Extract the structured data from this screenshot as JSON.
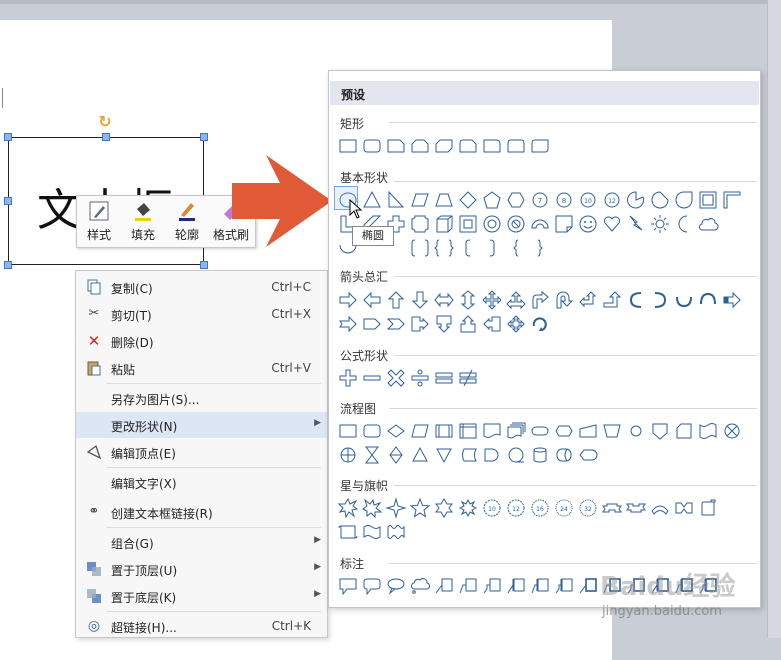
{
  "document": {
    "textbox_text": "文本框"
  },
  "mini_toolbar": {
    "buttons": [
      {
        "label": "样式",
        "icon": "brush-style-icon"
      },
      {
        "label": "填充",
        "icon": "paint-bucket-icon"
      },
      {
        "label": "轮廓",
        "icon": "pencil-outline-icon"
      },
      {
        "label": "格式刷",
        "icon": "format-painter-icon"
      }
    ]
  },
  "context_menu": {
    "items": [
      {
        "label": "复制(C)",
        "shortcut": "Ctrl+C",
        "icon": "copy-icon"
      },
      {
        "label": "剪切(T)",
        "shortcut": "Ctrl+X",
        "icon": "scissors-icon"
      },
      {
        "label": "删除(D)",
        "shortcut": "",
        "icon": "delete-x-icon"
      },
      {
        "label": "粘贴",
        "shortcut": "Ctrl+V",
        "icon": "paste-icon"
      },
      {
        "label": "另存为图片(S)...",
        "shortcut": "",
        "icon": ""
      },
      {
        "label": "更改形状(N)",
        "shortcut": "",
        "icon": "",
        "submenu": true,
        "highlighted": true
      },
      {
        "label": "编辑顶点(E)",
        "shortcut": "",
        "icon": "edit-points-icon"
      },
      {
        "label": "编辑文字(X)",
        "shortcut": "",
        "icon": ""
      },
      {
        "label": "创建文本框链接(R)",
        "shortcut": "",
        "icon": "link-chain-icon"
      },
      {
        "label": "组合(G)",
        "shortcut": "",
        "icon": "",
        "submenu": true
      },
      {
        "label": "置于顶层(U)",
        "shortcut": "",
        "icon": "bring-front-icon",
        "submenu": true
      },
      {
        "label": "置于底层(K)",
        "shortcut": "",
        "icon": "send-back-icon",
        "submenu": true
      },
      {
        "label": "超链接(H)...",
        "shortcut": "Ctrl+K",
        "icon": "hyperlink-globe-icon"
      }
    ]
  },
  "shape_panel": {
    "header": "预设",
    "sections": [
      {
        "title": "矩形"
      },
      {
        "title": "基本形状"
      },
      {
        "title": "箭头总汇"
      },
      {
        "title": "公式形状"
      },
      {
        "title": "流程图"
      },
      {
        "title": "星与旗帜"
      },
      {
        "title": "标注"
      }
    ],
    "tooltip": "椭圆"
  },
  "watermark": {
    "brand": "Baidu经验",
    "url": "jingyan.baidu.com"
  },
  "colors": {
    "arrow": "#e05a37",
    "icon_blue": "#2d5f9a",
    "highlight": "#dce6f4"
  }
}
